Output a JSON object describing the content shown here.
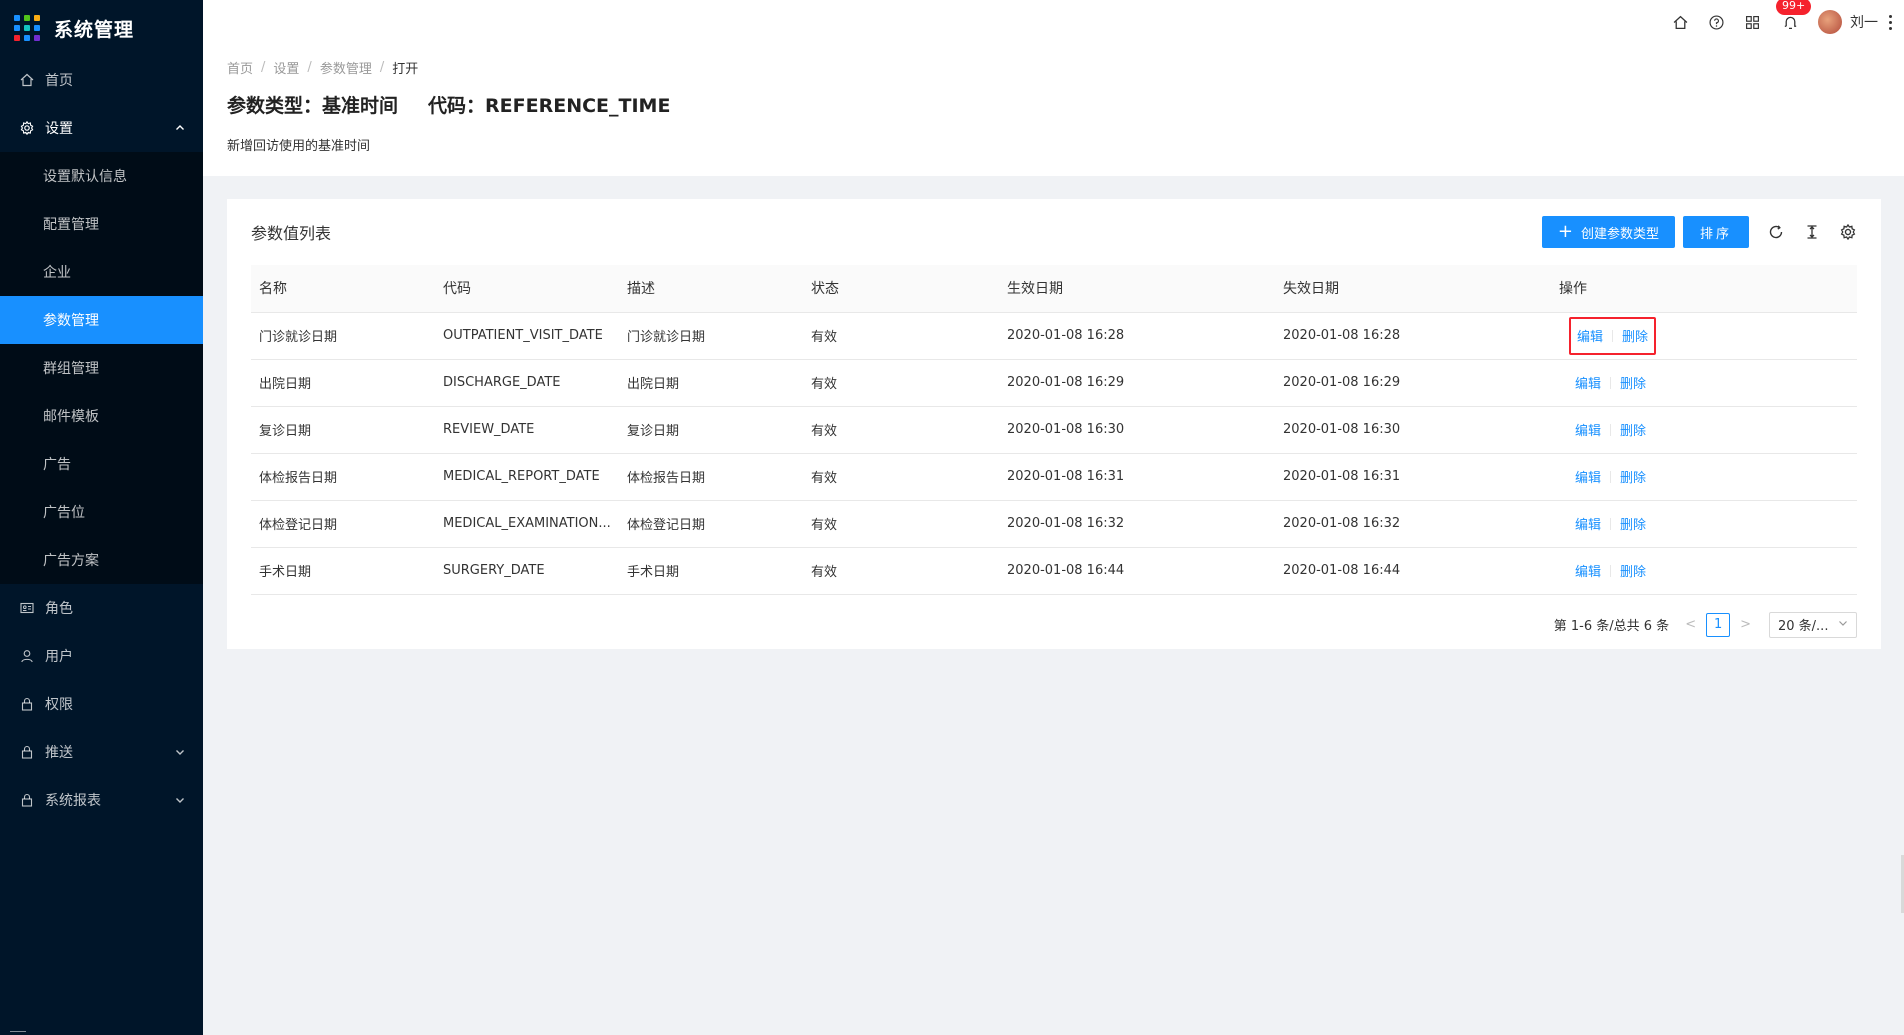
{
  "app": {
    "title": "系统管理",
    "logo_colors": [
      "#1890ff",
      "#52c41a",
      "#faad14",
      "#1890ff",
      "#13c2c2",
      "#1890ff",
      "#f5222d",
      "#1890ff",
      "#722ed1"
    ]
  },
  "sidebar": {
    "items": [
      {
        "label": "首页",
        "icon": "home-icon"
      },
      {
        "label": "设置",
        "icon": "gear-icon",
        "expanded": true,
        "children": [
          {
            "label": "设置默认信息"
          },
          {
            "label": "配置管理"
          },
          {
            "label": "企业"
          },
          {
            "label": "参数管理",
            "active": true
          },
          {
            "label": "群组管理"
          },
          {
            "label": "邮件模板"
          },
          {
            "label": "广告"
          },
          {
            "label": "广告位"
          },
          {
            "label": "广告方案"
          }
        ]
      },
      {
        "label": "角色",
        "icon": "id-card-icon"
      },
      {
        "label": "用户",
        "icon": "user-icon"
      },
      {
        "label": "权限",
        "icon": "lock-icon"
      },
      {
        "label": "推送",
        "icon": "lock-icon",
        "expandable": true
      },
      {
        "label": "系统报表",
        "icon": "lock-icon",
        "expandable": true
      }
    ]
  },
  "header": {
    "notification_badge": "99+",
    "username": "刘一"
  },
  "breadcrumb": [
    "首页",
    "设置",
    "参数管理",
    "打开"
  ],
  "page": {
    "title_type": "参数类型：基准时间",
    "title_code": "代码：REFERENCE_TIME",
    "description": "新增回访使用的基准时间"
  },
  "card": {
    "title": "参数值列表",
    "create_button": "创建参数类型",
    "sort_button": "排序"
  },
  "table": {
    "columns": [
      "名称",
      "代码",
      "描述",
      "状态",
      "生效日期",
      "失效日期",
      "操作"
    ],
    "rows": [
      {
        "name": "门诊就诊日期",
        "code": "OUTPATIENT_VISIT_DATE",
        "desc": "门诊就诊日期",
        "status": "有效",
        "start": "2020-01-08 16:28",
        "end": "2020-01-08 16:28"
      },
      {
        "name": "出院日期",
        "code": "DISCHARGE_DATE",
        "desc": "出院日期",
        "status": "有效",
        "start": "2020-01-08 16:29",
        "end": "2020-01-08 16:29"
      },
      {
        "name": "复诊日期",
        "code": "REVIEW_DATE",
        "desc": "复诊日期",
        "status": "有效",
        "start": "2020-01-08 16:30",
        "end": "2020-01-08 16:30"
      },
      {
        "name": "体检报告日期",
        "code": "MEDICAL_REPORT_DATE",
        "desc": "体检报告日期",
        "status": "有效",
        "start": "2020-01-08 16:31",
        "end": "2020-01-08 16:31"
      },
      {
        "name": "体检登记日期",
        "code": "MEDICAL_EXAMINATION...",
        "desc": "体检登记日期",
        "status": "有效",
        "start": "2020-01-08 16:32",
        "end": "2020-01-08 16:32"
      },
      {
        "name": "手术日期",
        "code": "SURGERY_DATE",
        "desc": "手术日期",
        "status": "有效",
        "start": "2020-01-08 16:44",
        "end": "2020-01-08 16:44"
      }
    ],
    "edit_label": "编辑",
    "delete_label": "删除"
  },
  "pagination": {
    "total_text": "第 1-6 条/总共 6 条",
    "current_page": "1",
    "page_size": "20 条/..."
  },
  "colors": {
    "primary": "#1890ff",
    "sidebar_bg": "#001529",
    "highlight_border": "#f5222d"
  }
}
